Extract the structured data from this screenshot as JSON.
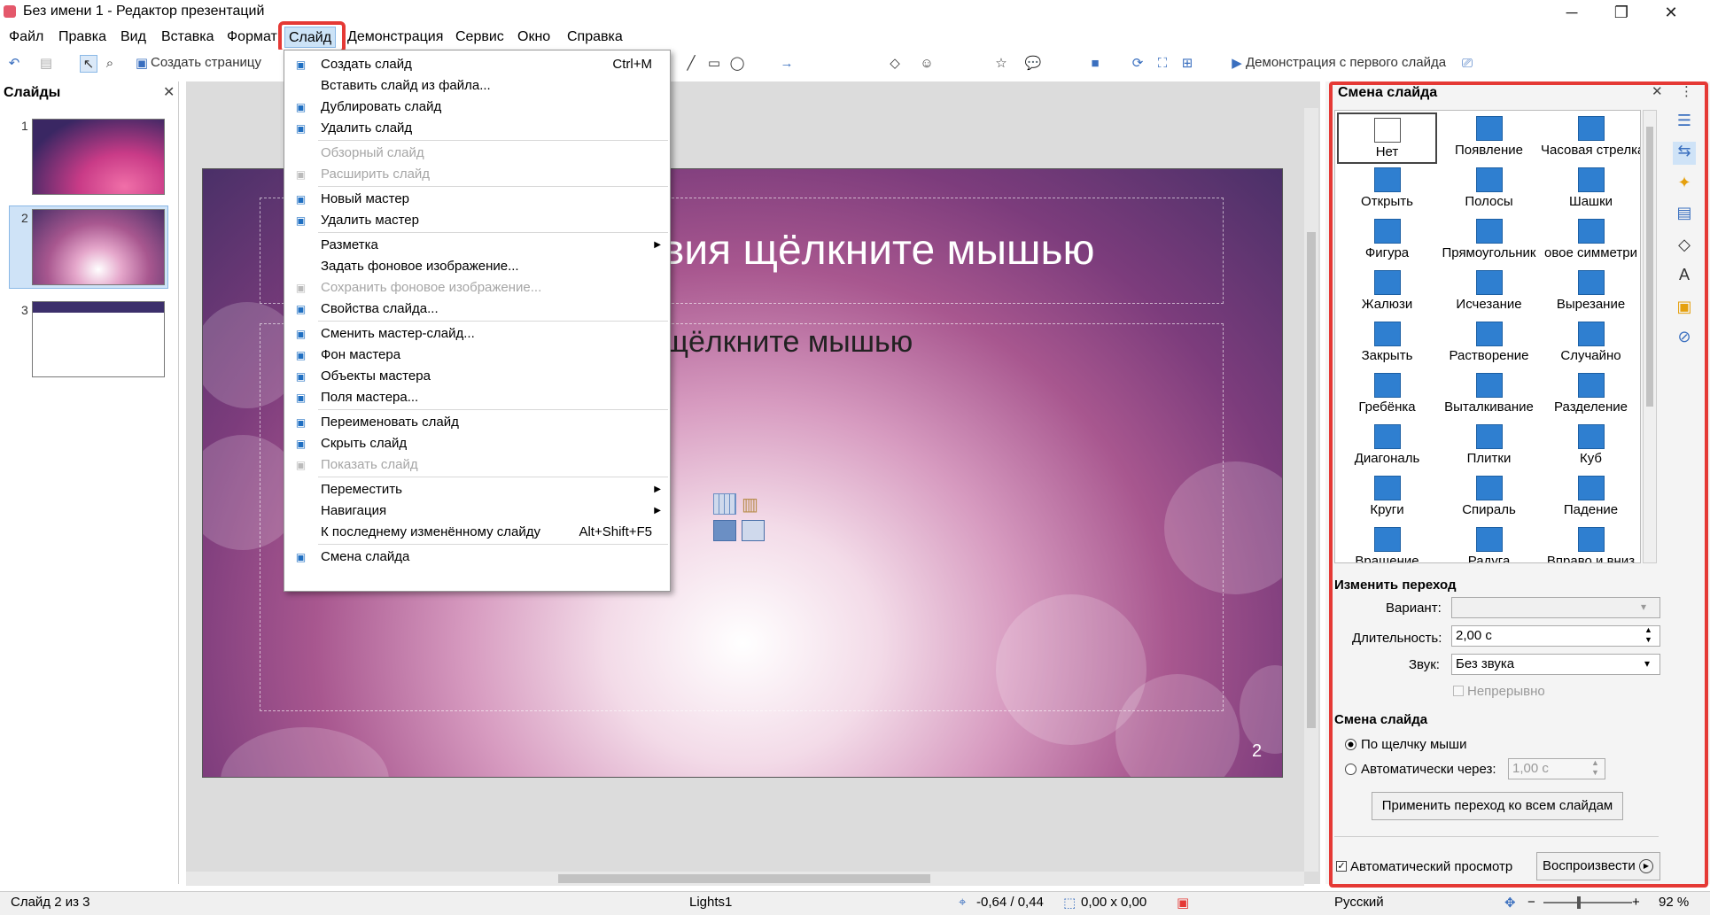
{
  "window": {
    "title": "Без имени 1 - Редактор презентаций",
    "minimize": "─",
    "maximize": "❐",
    "close": "✕"
  },
  "menubar": [
    "Файл",
    "Правка",
    "Вид",
    "Вставка",
    "Формат",
    "Слайд",
    "Демонстрация",
    "Сервис",
    "Окно",
    "Справка"
  ],
  "toolbar": {
    "new_page": "Создать страницу",
    "start_show": "Демонстрация с первого слайда"
  },
  "slides_panel": {
    "title": "Слайды",
    "close": "✕",
    "thumbs": [
      "1",
      "2",
      "3"
    ]
  },
  "slide": {
    "title": "Заголовок: для добавления заглавия щёлкните мышью",
    "title_visible": "аглавия щёлкните мышью",
    "title_prefix": "I",
    "subtitle_visible": "щёлкните мышью",
    "number": "2"
  },
  "dropdown": {
    "items": [
      {
        "label": "Создать слайд",
        "shortcut": "Ctrl+M",
        "icon": "new-slide-icon",
        "disabled": false
      },
      {
        "label": "Вставить слайд из файла...",
        "shortcut": "",
        "icon": "",
        "disabled": false
      },
      {
        "label": "Дублировать слайд",
        "shortcut": "",
        "icon": "duplicate-slide-icon",
        "disabled": false
      },
      {
        "label": "Удалить слайд",
        "shortcut": "",
        "icon": "delete-slide-icon",
        "disabled": false
      },
      {
        "sep": true
      },
      {
        "label": "Обзорный слайд",
        "shortcut": "",
        "icon": "",
        "disabled": true
      },
      {
        "label": "Расширить слайд",
        "shortcut": "",
        "icon": "expand-slide-icon",
        "disabled": true
      },
      {
        "sep": true
      },
      {
        "label": "Новый мастер",
        "shortcut": "",
        "icon": "new-master-icon",
        "disabled": false
      },
      {
        "label": "Удалить мастер",
        "shortcut": "",
        "icon": "delete-master-icon",
        "disabled": false
      },
      {
        "sep": true
      },
      {
        "label": "Разметка",
        "shortcut": "",
        "icon": "",
        "disabled": false,
        "submenu": true
      },
      {
        "label": "Задать фоновое изображение...",
        "shortcut": "",
        "icon": "",
        "disabled": false
      },
      {
        "label": "Сохранить фоновое изображение...",
        "shortcut": "",
        "icon": "save-bg-icon",
        "disabled": true
      },
      {
        "label": "Свойства слайда...",
        "shortcut": "",
        "icon": "slide-properties-icon",
        "disabled": false
      },
      {
        "sep": true
      },
      {
        "label": "Сменить мастер-слайд...",
        "shortcut": "",
        "icon": "change-master-icon",
        "disabled": false
      },
      {
        "label": "Фон мастера",
        "shortcut": "",
        "icon": "master-bg-icon",
        "disabled": false
      },
      {
        "label": "Объекты мастера",
        "shortcut": "",
        "icon": "master-objects-icon",
        "disabled": false
      },
      {
        "label": "Поля мастера...",
        "shortcut": "",
        "icon": "master-fields-icon",
        "disabled": false
      },
      {
        "sep": true
      },
      {
        "label": "Переименовать слайд",
        "shortcut": "",
        "icon": "rename-slide-icon",
        "disabled": false
      },
      {
        "label": "Скрыть слайд",
        "shortcut": "",
        "icon": "hide-slide-icon",
        "disabled": false
      },
      {
        "label": "Показать слайд",
        "shortcut": "",
        "icon": "show-slide-icon",
        "disabled": true
      },
      {
        "sep": true
      },
      {
        "label": "Переместить",
        "shortcut": "",
        "icon": "",
        "disabled": false,
        "submenu": true
      },
      {
        "label": "Навигация",
        "shortcut": "",
        "icon": "",
        "disabled": false,
        "submenu": true
      },
      {
        "label": "К последнему изменённому слайду",
        "shortcut": "Alt+Shift+F5",
        "icon": "",
        "disabled": false
      },
      {
        "sep": true
      },
      {
        "label": "Смена слайда",
        "shortcut": "",
        "icon": "slide-transition-icon",
        "disabled": false
      }
    ]
  },
  "sidebar": {
    "title": "Смена слайда",
    "close": "✕",
    "more": "⋮",
    "transitions": [
      "Нет",
      "Появление",
      "Часовая стрелка",
      "Открыть",
      "Полосы",
      "Шашки",
      "Фигура",
      "Прямоугольник",
      "овое симметри",
      "Жалюзи",
      "Исчезание",
      "Вырезание",
      "Закрыть",
      "Растворение",
      "Случайно",
      "Гребёнка",
      "Выталкивание",
      "Разделение",
      "Диагональ",
      "Плитки",
      "Куб",
      "Круги",
      "Спираль",
      "Падение",
      "Вращение",
      "Радуга",
      "Вправо и вниз"
    ],
    "modify_heading": "Изменить переход",
    "variant_label": "Вариант:",
    "variant_value": "",
    "duration_label": "Длительность:",
    "duration_value": "2,00 с",
    "sound_label": "Звук:",
    "sound_value": "Без звука",
    "loop_label": "Непрерывно",
    "advance_heading": "Смена слайда",
    "on_click_label": "По щелчку мыши",
    "auto_label": "Автоматически через:",
    "auto_value": "1,00 с",
    "apply_all": "Применить переход ко всем слайдам",
    "auto_preview": "Автоматический просмотр",
    "play": "Воспроизвести"
  },
  "status": {
    "slide": "Слайд 2 из 3",
    "master": "Lights1",
    "position": "-0,64 / 0,44",
    "size": "0,00 x 0,00",
    "language": "Русский",
    "zoom": "92 %"
  }
}
